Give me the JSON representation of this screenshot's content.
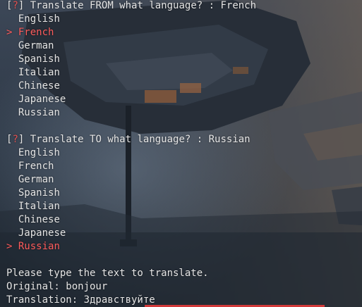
{
  "colors": {
    "prompt_text": "#e6e6e6",
    "question_mark": "#e05252",
    "selected": "#ff5c5c"
  },
  "from_prompt": {
    "bracket_open": "[",
    "mark": "?",
    "bracket_close": "]",
    "question": " Translate FROM what language? : French",
    "options": [
      {
        "label": "English",
        "selected": false
      },
      {
        "label": "French",
        "selected": true
      },
      {
        "label": "German",
        "selected": false
      },
      {
        "label": "Spanish",
        "selected": false
      },
      {
        "label": "Italian",
        "selected": false
      },
      {
        "label": "Chinese",
        "selected": false
      },
      {
        "label": "Japanese",
        "selected": false
      },
      {
        "label": "Russian",
        "selected": false
      }
    ]
  },
  "to_prompt": {
    "bracket_open": "[",
    "mark": "?",
    "bracket_close": "]",
    "question": " Translate TO what language? : Russian",
    "options": [
      {
        "label": "English",
        "selected": false
      },
      {
        "label": "French",
        "selected": false
      },
      {
        "label": "German",
        "selected": false
      },
      {
        "label": "Spanish",
        "selected": false
      },
      {
        "label": "Italian",
        "selected": false
      },
      {
        "label": "Chinese",
        "selected": false
      },
      {
        "label": "Japanese",
        "selected": false
      },
      {
        "label": "Russian",
        "selected": true
      }
    ]
  },
  "pointer_glyph": ">",
  "instruction": "Please type the text to translate.",
  "original_line": "Original: bonjour",
  "translation_line": "Translation: Здравствуйте"
}
